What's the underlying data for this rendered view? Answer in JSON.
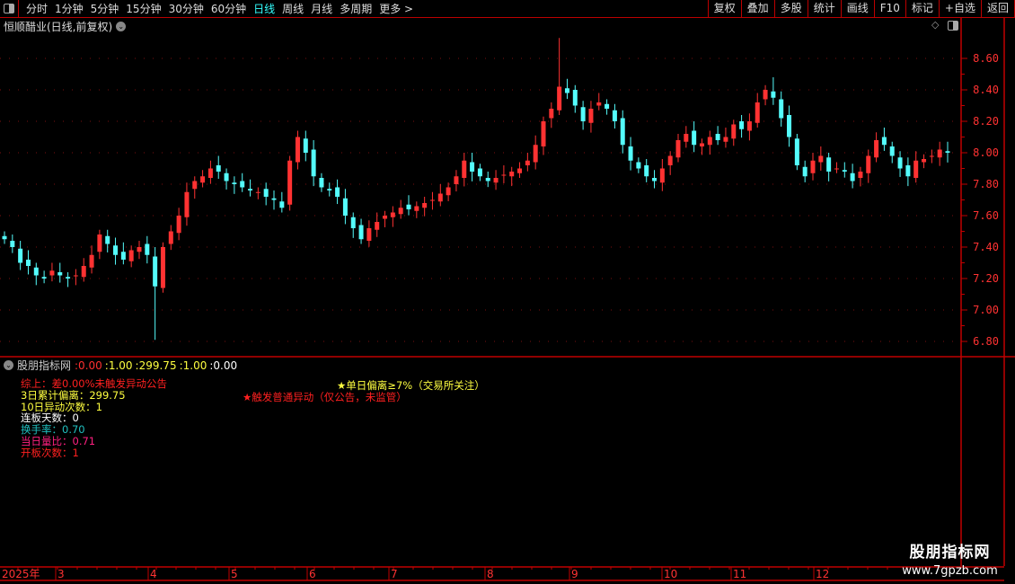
{
  "toolbar": {
    "periods": [
      "分时",
      "1分钟",
      "5分钟",
      "15分钟",
      "30分钟",
      "60分钟",
      "日线",
      "周线",
      "月线",
      "多周期",
      "更多 >"
    ],
    "active_period": "日线",
    "right_buttons": [
      "复权",
      "叠加",
      "多股",
      "统计",
      "画线",
      "F10",
      "标记",
      "+自选",
      "返回"
    ]
  },
  "chart": {
    "title": "恒顺醋业(日线,前复权)",
    "y_ticks": [
      "8.60",
      "8.40",
      "8.20",
      "8.00",
      "7.80",
      "7.60",
      "7.40",
      "7.20",
      "7.00",
      "6.80"
    ],
    "y_values": [
      8.6,
      8.4,
      8.2,
      8.0,
      7.8,
      7.6,
      7.4,
      7.2,
      7.0,
      6.8
    ],
    "ylim": [
      6.8,
      8.6
    ],
    "colors": {
      "up": "#ff3232",
      "down": "#54fcfc",
      "axis": "#c00000",
      "tick_text": "#ff3232"
    },
    "closes": [
      7.45,
      7.4,
      7.3,
      7.28,
      7.22,
      7.2,
      7.25,
      7.22,
      7.2,
      7.22,
      7.28,
      7.35,
      7.48,
      7.42,
      7.35,
      7.32,
      7.38,
      7.4,
      7.35,
      7.15,
      7.4,
      7.5,
      7.6,
      7.75,
      7.82,
      7.85,
      7.9,
      7.88,
      7.82,
      7.8,
      7.78,
      7.76,
      7.75,
      7.72,
      7.7,
      7.65,
      7.95,
      8.1,
      8.0,
      7.85,
      7.78,
      7.76,
      7.72,
      7.6,
      7.52,
      7.45,
      7.52,
      7.56,
      7.6,
      7.62,
      7.65,
      7.64,
      7.66,
      7.68,
      7.7,
      7.74,
      7.78,
      7.85,
      7.95,
      7.88,
      7.85,
      7.82,
      7.84,
      7.86,
      7.88,
      7.9,
      7.95,
      8.05,
      8.2,
      8.28,
      8.42,
      8.38,
      8.3,
      8.2,
      8.28,
      8.32,
      8.28,
      8.2,
      8.05,
      7.95,
      7.9,
      7.85,
      7.82,
      7.9,
      7.98,
      8.08,
      8.12,
      8.05,
      8.06,
      8.1,
      8.08,
      8.1,
      8.18,
      8.15,
      8.2,
      8.32,
      8.4,
      8.35,
      8.22,
      8.1,
      7.92,
      7.85,
      7.95,
      7.98,
      7.88,
      7.9,
      7.88,
      7.82,
      7.88,
      7.98,
      8.08,
      8.05,
      7.98,
      7.9,
      7.85,
      7.95,
      7.96,
      7.98,
      8.02,
      8.0
    ],
    "wick_extremes": [
      {
        "index": 19,
        "low": 6.81
      },
      {
        "index": 70,
        "high": 8.73
      },
      {
        "index": 97,
        "high": 8.48
      }
    ]
  },
  "indicator": {
    "name": "股朋指标网",
    "values": [
      ":0.00",
      ":1.00",
      ":299.75",
      ":1.00",
      ":0.00"
    ],
    "value_colors": [
      "#ff3030",
      "#ffff40",
      "#ffff40",
      "#ffff40",
      "#ffffff"
    ],
    "lines": [
      {
        "text": "综上：差0.00%未触发异动公告",
        "color": "#ff2020"
      },
      {
        "text": "3日累计偏离：299.75",
        "color": "#ffff40"
      },
      {
        "text": "10日异动次数：1",
        "color": "#ffff40"
      },
      {
        "text": "连板天数：0",
        "color": "#ffffff"
      },
      {
        "text": "换手率：0.70",
        "color": "#20c0c0"
      },
      {
        "text": "当日量比：0.71",
        "color": "#ff2080"
      },
      {
        "text": "开板次数：1",
        "color": "#ff2020"
      }
    ],
    "note_yellow": "★单日偏离≥7%（交易所关注）",
    "note_red": "★触发普通异动（仅公告，未监管）"
  },
  "x_axis": {
    "labels": [
      "2025年",
      "3",
      "4",
      "5",
      "6",
      "7",
      "8",
      "9",
      "10",
      "11",
      "12"
    ]
  },
  "watermark": {
    "title": "股朋指标网",
    "url": "www.7gpzb.com"
  }
}
